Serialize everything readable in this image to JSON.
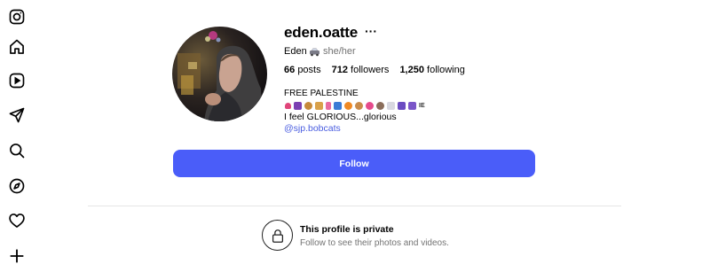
{
  "sidebar": {
    "items": [
      {
        "icon": "instagram-logo-icon"
      },
      {
        "icon": "home-icon"
      },
      {
        "icon": "reels-icon"
      },
      {
        "icon": "direct-messages-icon"
      },
      {
        "icon": "search-icon"
      },
      {
        "icon": "explore-icon"
      },
      {
        "icon": "notifications-heart-icon"
      },
      {
        "icon": "create-plus-icon"
      }
    ]
  },
  "profile": {
    "username": "eden.oatte",
    "more_label": "···",
    "full_name": "Eden",
    "name_emoji": "car-icon",
    "pronouns": "she/her",
    "stats": {
      "posts_count": "66",
      "posts_label": "posts",
      "followers_count": "712",
      "followers_label": "followers",
      "following_count": "1,250",
      "following_label": "following"
    },
    "bio_line1": "FREE PALESTINE",
    "bio_emoji_line_end": "IE",
    "bio_line2": "I feel GLORIOUS...glorious",
    "bio_mention": "@sjp.bobcats"
  },
  "actions": {
    "follow_label": "Follow"
  },
  "private_notice": {
    "icon": "lock-icon",
    "title": "This profile is private",
    "subtitle": "Follow to see their photos and videos."
  },
  "colors": {
    "accent": "#4a5df9",
    "link": "#4a5de0",
    "secondary_text": "#737373"
  }
}
